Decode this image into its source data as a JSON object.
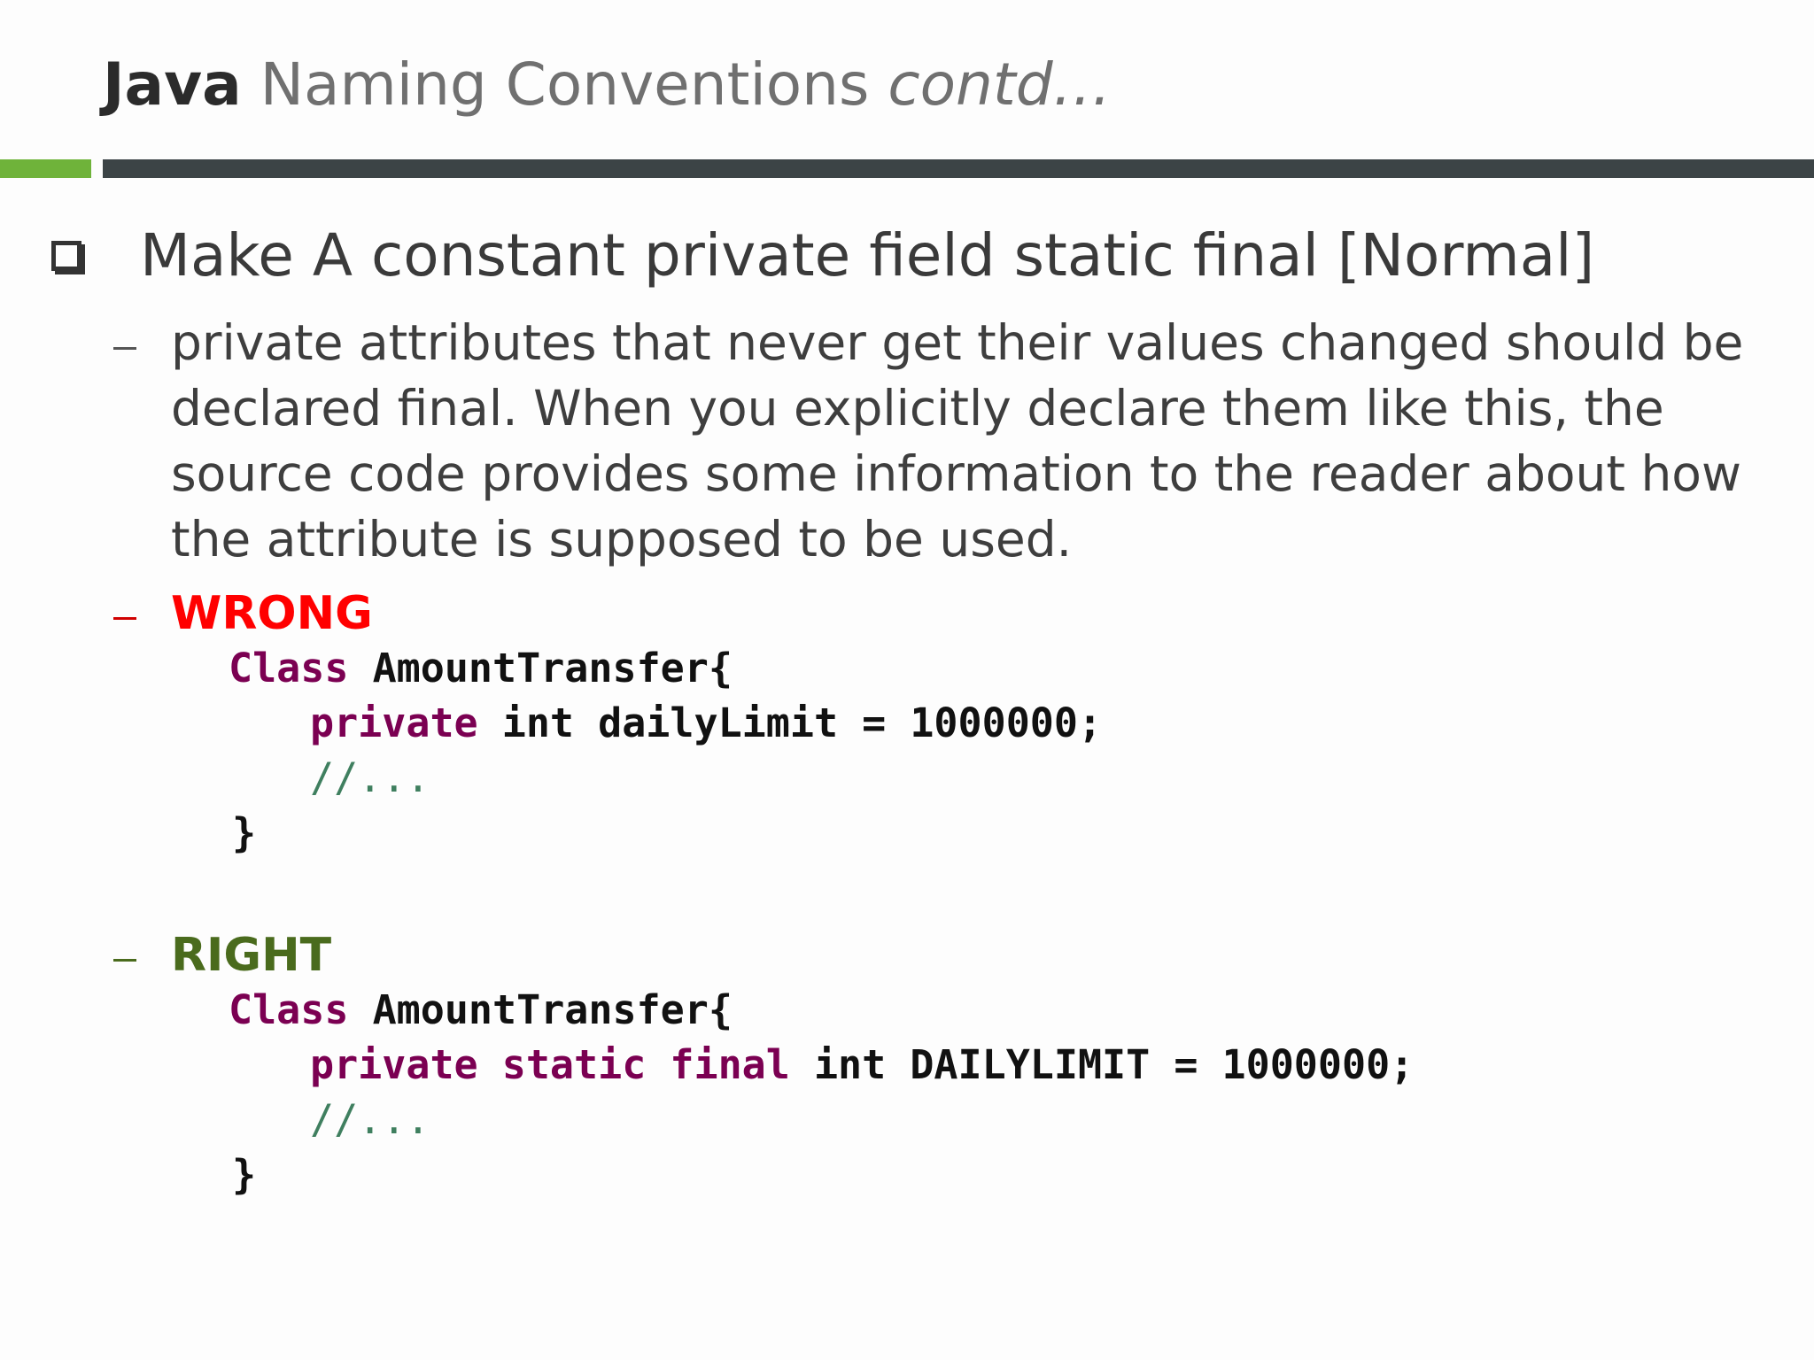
{
  "title": {
    "bold": "Java",
    "regular": "Naming Conventions",
    "italic": "contd…"
  },
  "main_point": "Make A constant private field static final [Normal]",
  "explanation_lines": [
    "private attributes that never get their values changed should be",
    "declared final. When you explicitly declare them like this, the",
    "source code provides some information to the reader about how",
    "the attribute is supposed to be used."
  ],
  "wrong": {
    "label": "WRONG",
    "class_kw": "Class",
    "class_name": "AmountTransfer{",
    "field_kw": "private",
    "field_rest": "int dailyLimit = 1000000;",
    "comment": "//...",
    "close": "}"
  },
  "right": {
    "label": "RIGHT",
    "class_kw": "Class",
    "class_name": "AmountTransfer{",
    "field_kw": "private static final",
    "field_rest": "int DAILYLIMIT = 1000000;",
    "comment": "//...",
    "close": "}"
  },
  "colors": {
    "accent_green": "#6fb33a",
    "bar_dark": "#3c4446",
    "wrong_red": "#ff0000",
    "right_green": "#4a6b1d",
    "keyword_purple": "#7b0052",
    "comment_green": "#3f7f5f"
  }
}
